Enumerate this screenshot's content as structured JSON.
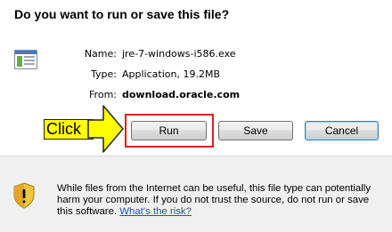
{
  "dialog": {
    "title": "Do you want to run or save this file?"
  },
  "file_info": {
    "icon": "application-file-icon",
    "name_label": "Name:",
    "name_value": "jre-7-windows-i586.exe",
    "type_label": "Type:",
    "type_value": "Application, 19.2MB",
    "from_label": "From:",
    "from_value": "download.oracle.com"
  },
  "buttons": {
    "run": "Run",
    "save": "Save",
    "cancel": "Cancel"
  },
  "annotation": {
    "click_label": "Click",
    "highlight_color": "#e0201a",
    "label_color": "#ffff00"
  },
  "warning": {
    "icon": "security-shield-icon",
    "text": "While files from the Internet can be useful, this file type can potentially harm your computer. If you do not trust the source, do not run or save this software.",
    "link": "What's the risk?"
  }
}
